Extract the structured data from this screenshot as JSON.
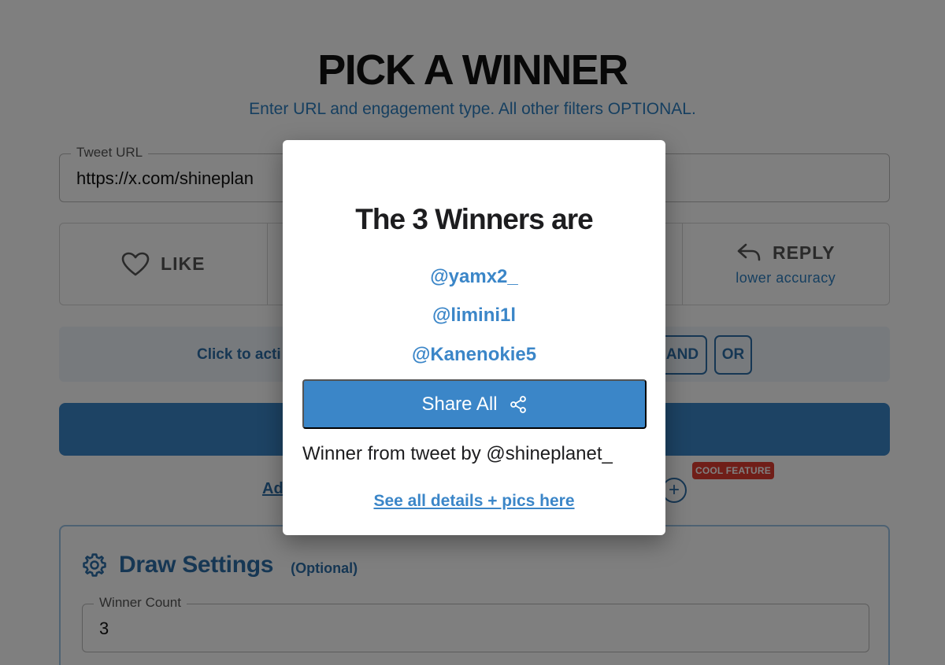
{
  "header": {
    "title": "PICK A WINNER",
    "subtitle": "Enter URL and engagement type. All other filters OPTIONAL."
  },
  "url_field": {
    "label": "Tweet URL",
    "value": "https://x.com/shineplan"
  },
  "engagement": {
    "like_label": "LIKE",
    "reply_label": "REPLY",
    "reply_note": "lower accuracy"
  },
  "filter_toggle": {
    "text": "Click to acti",
    "and_label": "AND",
    "or_label": "OR"
  },
  "advanced": {
    "link_text": "Ad",
    "badge": "COOL FEATURE"
  },
  "draw_settings": {
    "title": "Draw Settings",
    "optional": "(Optional)",
    "winner_count_label": "Winner Count",
    "winner_count_value": "3"
  },
  "modal": {
    "title": "The 3 Winners are",
    "winners": [
      "@yamx2_",
      "@limini1l",
      "@Kanenokie5"
    ],
    "share_label": "Share All",
    "note": "Winner from tweet by @shineplanet_",
    "details_link": "See all details + pics here"
  },
  "colors": {
    "accent": "#3b86c8",
    "accent_dark": "#2d6ea8",
    "badge": "#e03c31"
  }
}
